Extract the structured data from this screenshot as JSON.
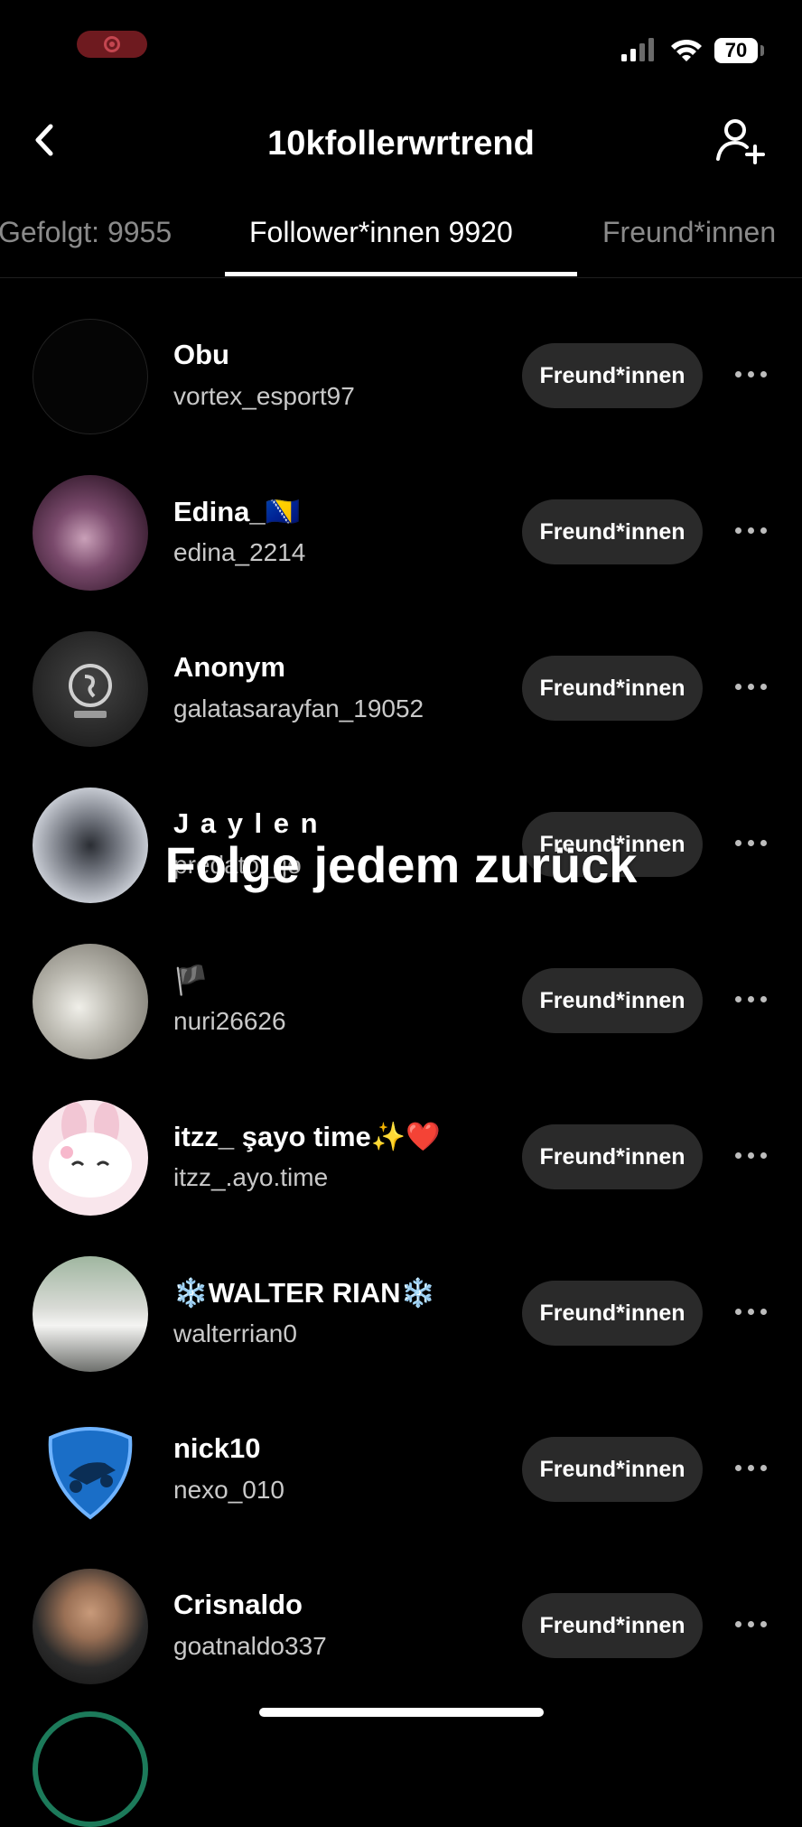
{
  "status_bar": {
    "battery": "70"
  },
  "header": {
    "title": "10kfollerwrtrend"
  },
  "tabs": [
    {
      "label": "Gefolgt: 9955"
    },
    {
      "label": "Follower*innen 9920"
    },
    {
      "label": "Freund*innen"
    }
  ],
  "overlay": {
    "caption": "Folge jedem zurück"
  },
  "followers": [
    {
      "name": "Obu",
      "handle": "vortex_esport97",
      "button": "Freund*innen",
      "avatar": "dark-avatar"
    },
    {
      "name": "Edina_🇧🇦",
      "handle": "edina_2214",
      "button": "Freund*innen",
      "avatar": "photo-avatar"
    },
    {
      "name": "Anonym",
      "handle": "galatasarayfan_19052",
      "button": "Freund*innen",
      "avatar": "club-logo-avatar"
    },
    {
      "name": "J a y l e n",
      "handle": "predator_jo",
      "button": "Freund*innen",
      "avatar": "photo-avatar"
    },
    {
      "name": "🏴",
      "handle": "nuri26626",
      "button": "Freund*innen",
      "avatar": "photo-avatar"
    },
    {
      "name": "itzz_ şayo time✨❤️",
      "handle": "itzz_.ayo.time",
      "button": "Freund*innen",
      "avatar": "cartoon-avatar"
    },
    {
      "name": "❄️WALTER RIAN❄️",
      "handle": "walterrian0",
      "button": "Freund*innen",
      "avatar": "photo-avatar"
    },
    {
      "name": "nick10",
      "handle": "nexo_010",
      "button": "Freund*innen",
      "avatar": "game-logo-avatar"
    },
    {
      "name": "Crisnaldo",
      "handle": "goatnaldo337",
      "button": "Freund*innen",
      "avatar": "photo-avatar"
    }
  ]
}
